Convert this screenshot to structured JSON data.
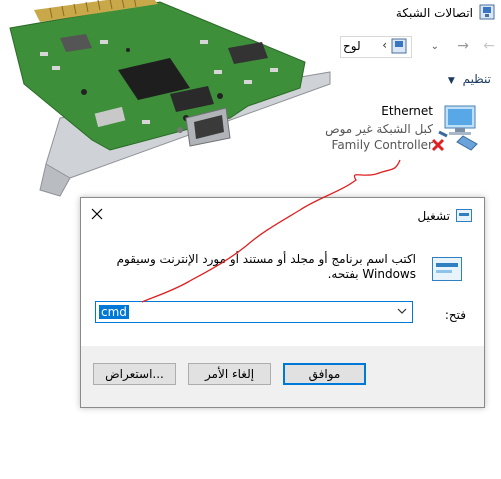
{
  "network_window": {
    "title": "اتصالات الشبكة",
    "address_text": "لوح",
    "organize_label": "تنظيم"
  },
  "adapter": {
    "name": "Ethernet",
    "status": "كبل الشبكة غير موص",
    "device": "Family Controller"
  },
  "run_dialog": {
    "title": "تشغيل",
    "description": "اكتب اسم برنامج أو مجلد أو مستند أو مورد الإنترنت وسيقوم Windows بفتحه.",
    "open_label": "فتح:",
    "open_value": "cmd",
    "buttons": {
      "ok": "موافق",
      "cancel": "إلغاء الأمر",
      "browse": "استعراض..."
    }
  },
  "colors": {
    "accent": "#0078d7",
    "annotation": "#e02020",
    "pcb_green": "#3d8f3a"
  },
  "icons": [
    "close-icon",
    "run-icon",
    "network-adapter-icon",
    "disconnected-x-icon",
    "chevron-down-icon",
    "back-arrow-icon",
    "forward-arrow-icon",
    "up-arrow-icon"
  ]
}
